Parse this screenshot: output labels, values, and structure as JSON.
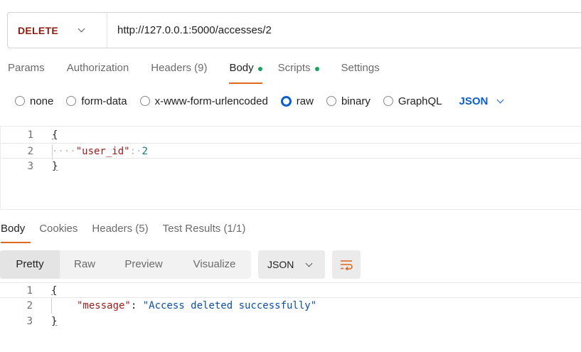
{
  "request": {
    "method": "DELETE",
    "url": "http://127.0.0.1:5000/accesses/2"
  },
  "request_tabs": [
    {
      "label": "Params",
      "active": false,
      "dot": false
    },
    {
      "label": "Authorization",
      "active": false,
      "dot": false
    },
    {
      "label": "Headers (9)",
      "active": false,
      "dot": false
    },
    {
      "label": "Body",
      "active": true,
      "dot": true
    },
    {
      "label": "Scripts",
      "active": false,
      "dot": true
    },
    {
      "label": "Settings",
      "active": false,
      "dot": false
    }
  ],
  "body_types": {
    "options": [
      "none",
      "form-data",
      "x-www-form-urlencoded",
      "raw",
      "binary",
      "GraphQL"
    ],
    "selected": "raw",
    "format": "JSON"
  },
  "request_body": {
    "lines": [
      {
        "num": "1",
        "text": "{"
      },
      {
        "num": "2",
        "indent": "····",
        "key": "\"user_id\"",
        "sep": ":·",
        "value": "2"
      },
      {
        "num": "3",
        "text": "}"
      }
    ]
  },
  "response_tabs": [
    {
      "label": "Body",
      "active": true
    },
    {
      "label": "Cookies",
      "active": false
    },
    {
      "label": "Headers (5)",
      "active": false
    },
    {
      "label": "Test Results (1/1)",
      "active": false
    }
  ],
  "response_view": {
    "modes": [
      "Pretty",
      "Raw",
      "Preview",
      "Visualize"
    ],
    "active": "Pretty",
    "format": "JSON"
  },
  "response_body": {
    "lines": [
      {
        "num": "1",
        "text": "{"
      },
      {
        "num": "2",
        "key": "\"message\"",
        "sep": ": ",
        "value": "\"Access deleted successfully\""
      },
      {
        "num": "3",
        "text": "}"
      }
    ]
  },
  "colors": {
    "method": "#8e1a10",
    "accent_tab": "#e0691f",
    "dot": "#18a35a",
    "link_blue": "#0b5fcc",
    "wrap_icon": "#e0691f"
  }
}
